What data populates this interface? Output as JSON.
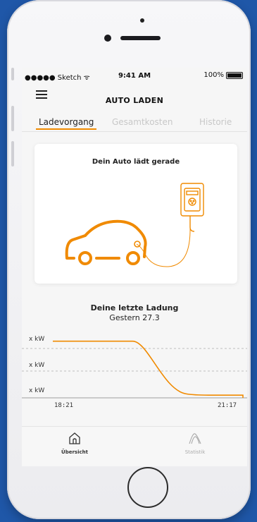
{
  "status_bar": {
    "carrier": "●●●●● Sketch ᯤ",
    "time": "9:41 AM",
    "battery": "100%"
  },
  "header": {
    "title": "AUTO LADEN"
  },
  "tabs": [
    {
      "label": "Ladevorgang",
      "active": true
    },
    {
      "label": "Gesamtkosten",
      "active": false
    },
    {
      "label": "Historie",
      "active": false
    }
  ],
  "status_card": {
    "title": "Dein Auto lädt gerade"
  },
  "last_charge": {
    "title": "Deine letzte Ladung",
    "date": "Gestern 27.3"
  },
  "chart_data": {
    "type": "line",
    "y_tick_labels": [
      "x kW",
      "x kW",
      "x kW"
    ],
    "x_tick_labels": [
      "18:21",
      "21:17"
    ],
    "series": [
      {
        "points": [
          [
            0,
            3
          ],
          [
            0.42,
            3
          ],
          [
            0.55,
            2.1
          ],
          [
            0.7,
            1.05
          ],
          [
            0.82,
            1.0
          ],
          [
            1.0,
            1.0
          ],
          [
            1.0,
            0.9
          ]
        ]
      }
    ],
    "ylim": [
      0.9,
      3.2
    ]
  },
  "bottom_tabs": [
    {
      "label": "Übersicht",
      "icon": "home-icon",
      "active": true
    },
    {
      "label": "Statistik",
      "icon": "statistic-icon",
      "active": false
    }
  ],
  "colors": {
    "accent": "#f08a00",
    "background": "#1f57a8"
  }
}
